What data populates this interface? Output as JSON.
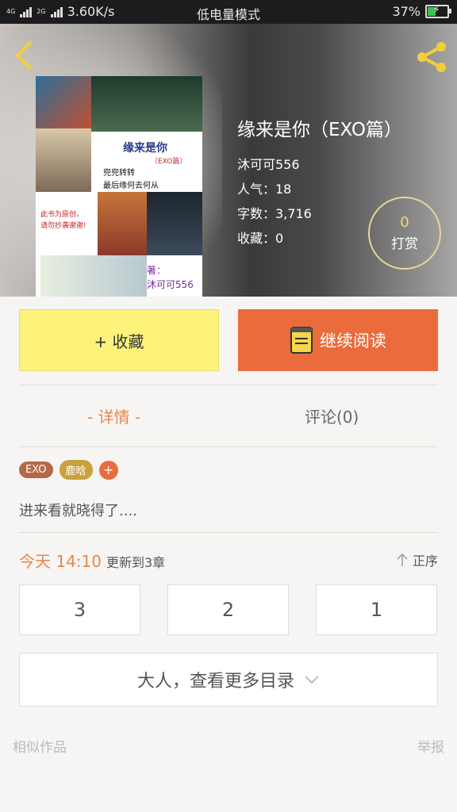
{
  "status": {
    "net_left": "4G",
    "net_right": "2G",
    "speed": "3.60K/s",
    "mode": "低电量模式",
    "battery": "37%"
  },
  "book": {
    "title": "缘来是你（EXO篇）",
    "author": "沐可可556",
    "popularity": "人气：18",
    "words": "字数：3,716",
    "favorites": "收藏：0",
    "tip_count": "0",
    "tip_label": "打赏"
  },
  "cover": {
    "title": "缘来是你",
    "sub": "（EXO篇）",
    "note1": "兜兜转转",
    "note2": "最后缘何去何从",
    "red1": "此书为原创，",
    "red2": "请勿抄袭谢谢!",
    "author1": "著：",
    "author2": "沐可可556"
  },
  "actions": {
    "favorite": "+ 收藏",
    "continue": "继续阅读"
  },
  "tabs": {
    "detail": "- 详情 -",
    "comments": "评论(0)"
  },
  "tags": [
    "EXO",
    "鹿晗",
    "+"
  ],
  "description": "进来看就晓得了....",
  "update": {
    "date": "今天 14:10",
    "text": "更新到3章",
    "order": "正序"
  },
  "chapters": [
    "3",
    "2",
    "1"
  ],
  "more": "大人，查看更多目录",
  "footer": {
    "similar": "相似作品",
    "report": "举报"
  },
  "colors": {
    "accent": "#ea6b3b",
    "favorite_bg": "#fdf37a",
    "tab_active": "#e8874a"
  }
}
